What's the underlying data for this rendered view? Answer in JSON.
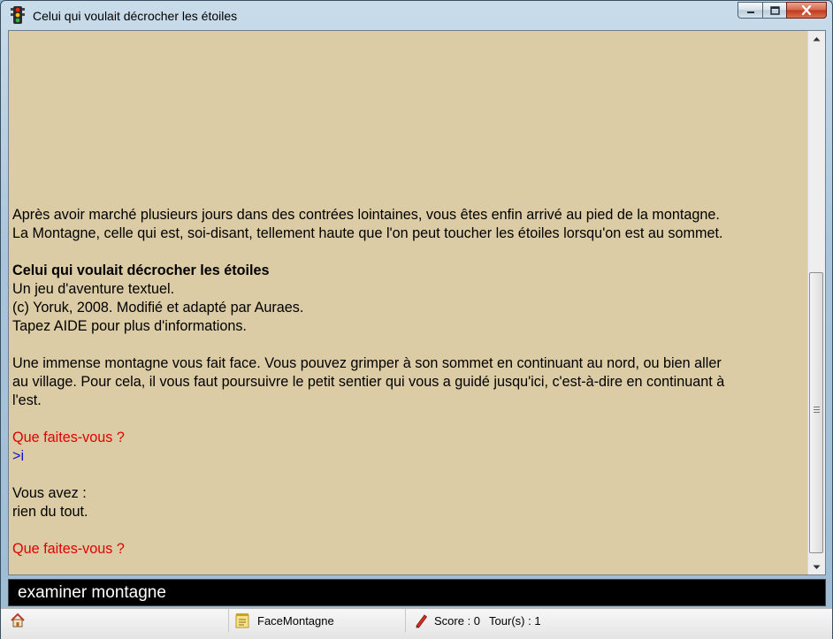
{
  "window": {
    "title": "Celui qui voulait décrocher les étoiles",
    "icon": "traffic-light-icon",
    "buttons": {
      "minimize": "minimize-icon",
      "maximize": "maximize-icon",
      "close": "close-icon"
    }
  },
  "story": {
    "intro_line1": "Après avoir marché plusieurs jours dans des contrées lointaines, vous êtes enfin arrivé au pied de la montagne.",
    "intro_line2": "La Montagne, celle qui est, soi-disant, tellement haute que l'on peut toucher les étoiles lorsqu'on est au sommet.",
    "game_title": "Celui qui voulait décrocher les étoiles",
    "subtitle": "Un jeu d'aventure textuel.",
    "credits": "(c) Yoruk, 2008. Modifié et adapté par Auraes.",
    "help_hint": "Tapez AIDE pour plus d'informations.",
    "room_desc_line1": "Une immense montagne vous fait face. Vous pouvez grimper à son sommet en continuant au nord, ou bien aller",
    "room_desc_line2": "au village. Pour cela, il vous faut poursuivre le petit sentier qui vous a guidé jusqu'ici, c'est-à-dire en continuant à",
    "room_desc_line3": "l'est.",
    "prompt1": "Que faites-vous ?",
    "command_echo": ">i",
    "inventory_header": "Vous avez :",
    "inventory_content": "rien du tout.",
    "prompt2": "Que faites-vous ?"
  },
  "input": {
    "value": "examiner montagne"
  },
  "statusbar": {
    "home_icon": "home-icon",
    "room_icon": "notepad-icon",
    "room_name": "FaceMontagne",
    "score_icon": "pencil-icon",
    "score": "Score : 0",
    "turns": "Tour(s) : 1"
  },
  "colors": {
    "page_background": "#dccca5",
    "prompt": "#e00000",
    "command_echo": "#1010d0",
    "input_background": "#000000"
  }
}
